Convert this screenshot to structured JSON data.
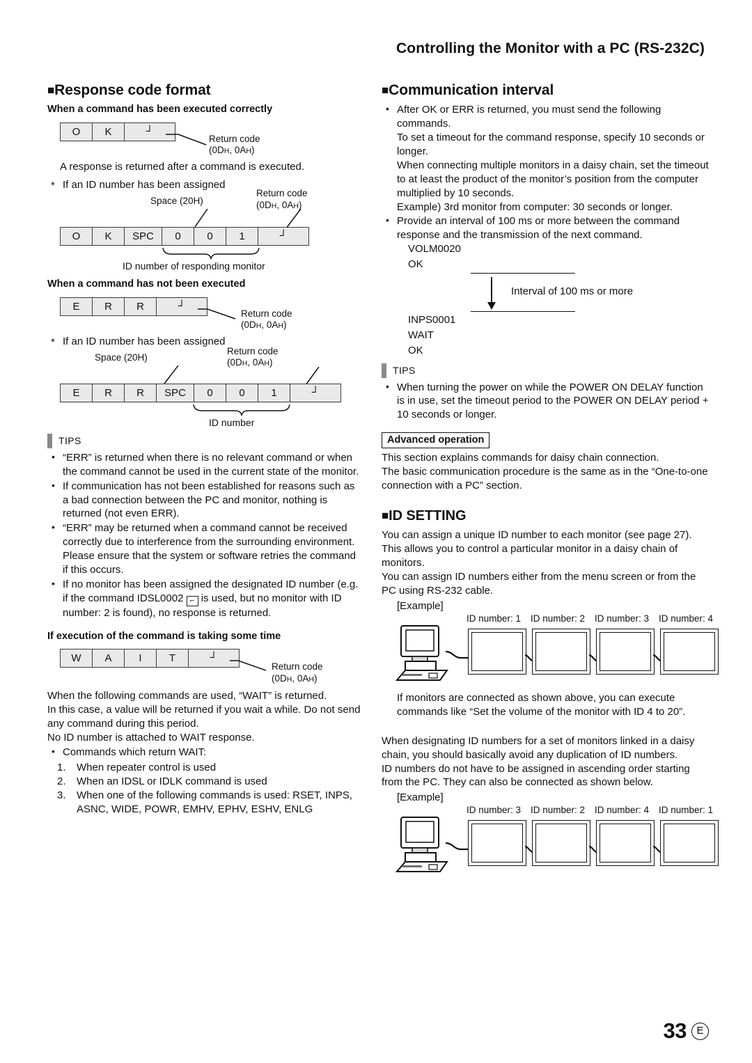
{
  "header": {
    "title": "Controlling the Monitor with a PC (RS-232C)"
  },
  "left": {
    "section_title": "Response code format",
    "sub1": "When a command has been executed correctly",
    "ok_cells": [
      "O",
      "K",
      "┘"
    ],
    "return_code_label": "Return code",
    "return_code_hex": "(0DH, 0AH)",
    "ok_note": "A response is returned after a command is executed.",
    "star_note_1": "If an ID number has been assigned",
    "space_label": "Space (20H)",
    "ok_id_cells": [
      "O",
      "K",
      "SPC",
      "0",
      "0",
      "1",
      "┘"
    ],
    "ok_id_brace_label": "ID number of responding monitor",
    "sub2": "When a command has not been executed",
    "err_cells": [
      "E",
      "R",
      "R",
      "┘"
    ],
    "star_note_2": "If an ID number has been assigned",
    "err_id_cells": [
      "E",
      "R",
      "R",
      "SPC",
      "0",
      "0",
      "1",
      "┘"
    ],
    "err_id_brace_label": "ID number",
    "tips_label": "TIPS",
    "tips": [
      "“ERR” is returned when there is no relevant command or when the command cannot be used in the current state of the monitor.",
      "If communication has not been established for reasons such as a bad connection between the PC and monitor, nothing is returned (not even ERR).",
      "“ERR” may be returned when a command cannot be received correctly due to interference from the surrounding environment.",
      "Please ensure that the system or software retries the command if this occurs.",
      "If no monitor has been assigned the designated ID number (e.g. if the command IDSL0002",
      "is used, but no monitor with ID number: 2 is found), no response is returned."
    ],
    "sub3": "If execution of the command is taking some time",
    "wait_cells": [
      "W",
      "A",
      "I",
      "T",
      "┘"
    ],
    "wait_para": [
      "When the following commands are used, “WAIT” is returned.",
      "In this case, a value will be returned if you wait a while. Do not send any command during this period.",
      "No ID number is attached to WAIT response."
    ],
    "wait_bullet": "Commands which return WAIT:",
    "wait_items": [
      {
        "n": "1.",
        "text": "When repeater control is used"
      },
      {
        "n": "2.",
        "text": "When an IDSL or IDLK command is used"
      },
      {
        "n": "3.",
        "text": "When one of the following commands is used: RSET, INPS, ASNC, WIDE, POWR, EMHV, EPHV, ESHV, ENLG"
      }
    ]
  },
  "right": {
    "section_title": "Communication interval",
    "bullets": [
      {
        "main": "After OK or ERR is returned, you must send the following commands.",
        "subs": [
          "To set a timeout for the command response, specify 10 seconds or longer.",
          "When connecting multiple monitors in a daisy chain, set the timeout to at least the product of the monitor’s position from the computer multiplied by 10 seconds.",
          "Example) 3rd monitor from computer: 30 seconds or longer."
        ]
      },
      {
        "main": "Provide an interval of 100 ms or more between the command response and the transmission of the next command.",
        "subs": []
      }
    ],
    "interval": {
      "line1": "VOLM0020",
      "line2": "OK",
      "arrow_label": "Interval of 100 ms or more",
      "line3": "INPS0001",
      "line4": "WAIT",
      "line5": "OK"
    },
    "tips_label": "TIPS",
    "tips": [
      "When turning the power on while the POWER ON DELAY function is in use, set the timeout period to the POWER ON DELAY period + 10 seconds or longer."
    ],
    "advanced_label": "Advanced operation",
    "advanced_text": [
      "This section explains commands for daisy chain connection.",
      "The basic communication procedure is the same as in the “One-to-one connection with a PC” section."
    ],
    "id_setting_title": "ID SETTING",
    "id_para1": [
      "You can assign a unique ID number to each monitor (see page 27). This allows you to control a particular monitor in a daisy chain of monitors.",
      "You can assign ID numbers either from the menu screen or from the PC using RS-232 cable."
    ],
    "example_label": "[Example]",
    "chain1": [
      "ID number: 1",
      "ID number: 2",
      "ID number: 3",
      "ID number: 4"
    ],
    "id_para2": [
      "If monitors are connected as shown above, you can execute commands like “Set the volume of the monitor with ID 4 to 20”."
    ],
    "id_para3": [
      "When designating ID numbers for a set of monitors linked in a daisy chain, you should basically avoid any duplication of ID numbers.",
      "ID numbers do not have to be assigned in ascending order starting from the PC. They can also be connected as shown below."
    ],
    "example_label2": "[Example]",
    "chain2": [
      "ID number: 3",
      "ID number: 2",
      "ID number: 4",
      "ID number: 1"
    ]
  },
  "footer": {
    "page_number": "33",
    "edition": "E"
  },
  "colors": {
    "cell_fill": "#e9e9e9",
    "cell_border": "#3a3a3a",
    "tips_bar": "#8a8a8a",
    "text": "#111111"
  }
}
